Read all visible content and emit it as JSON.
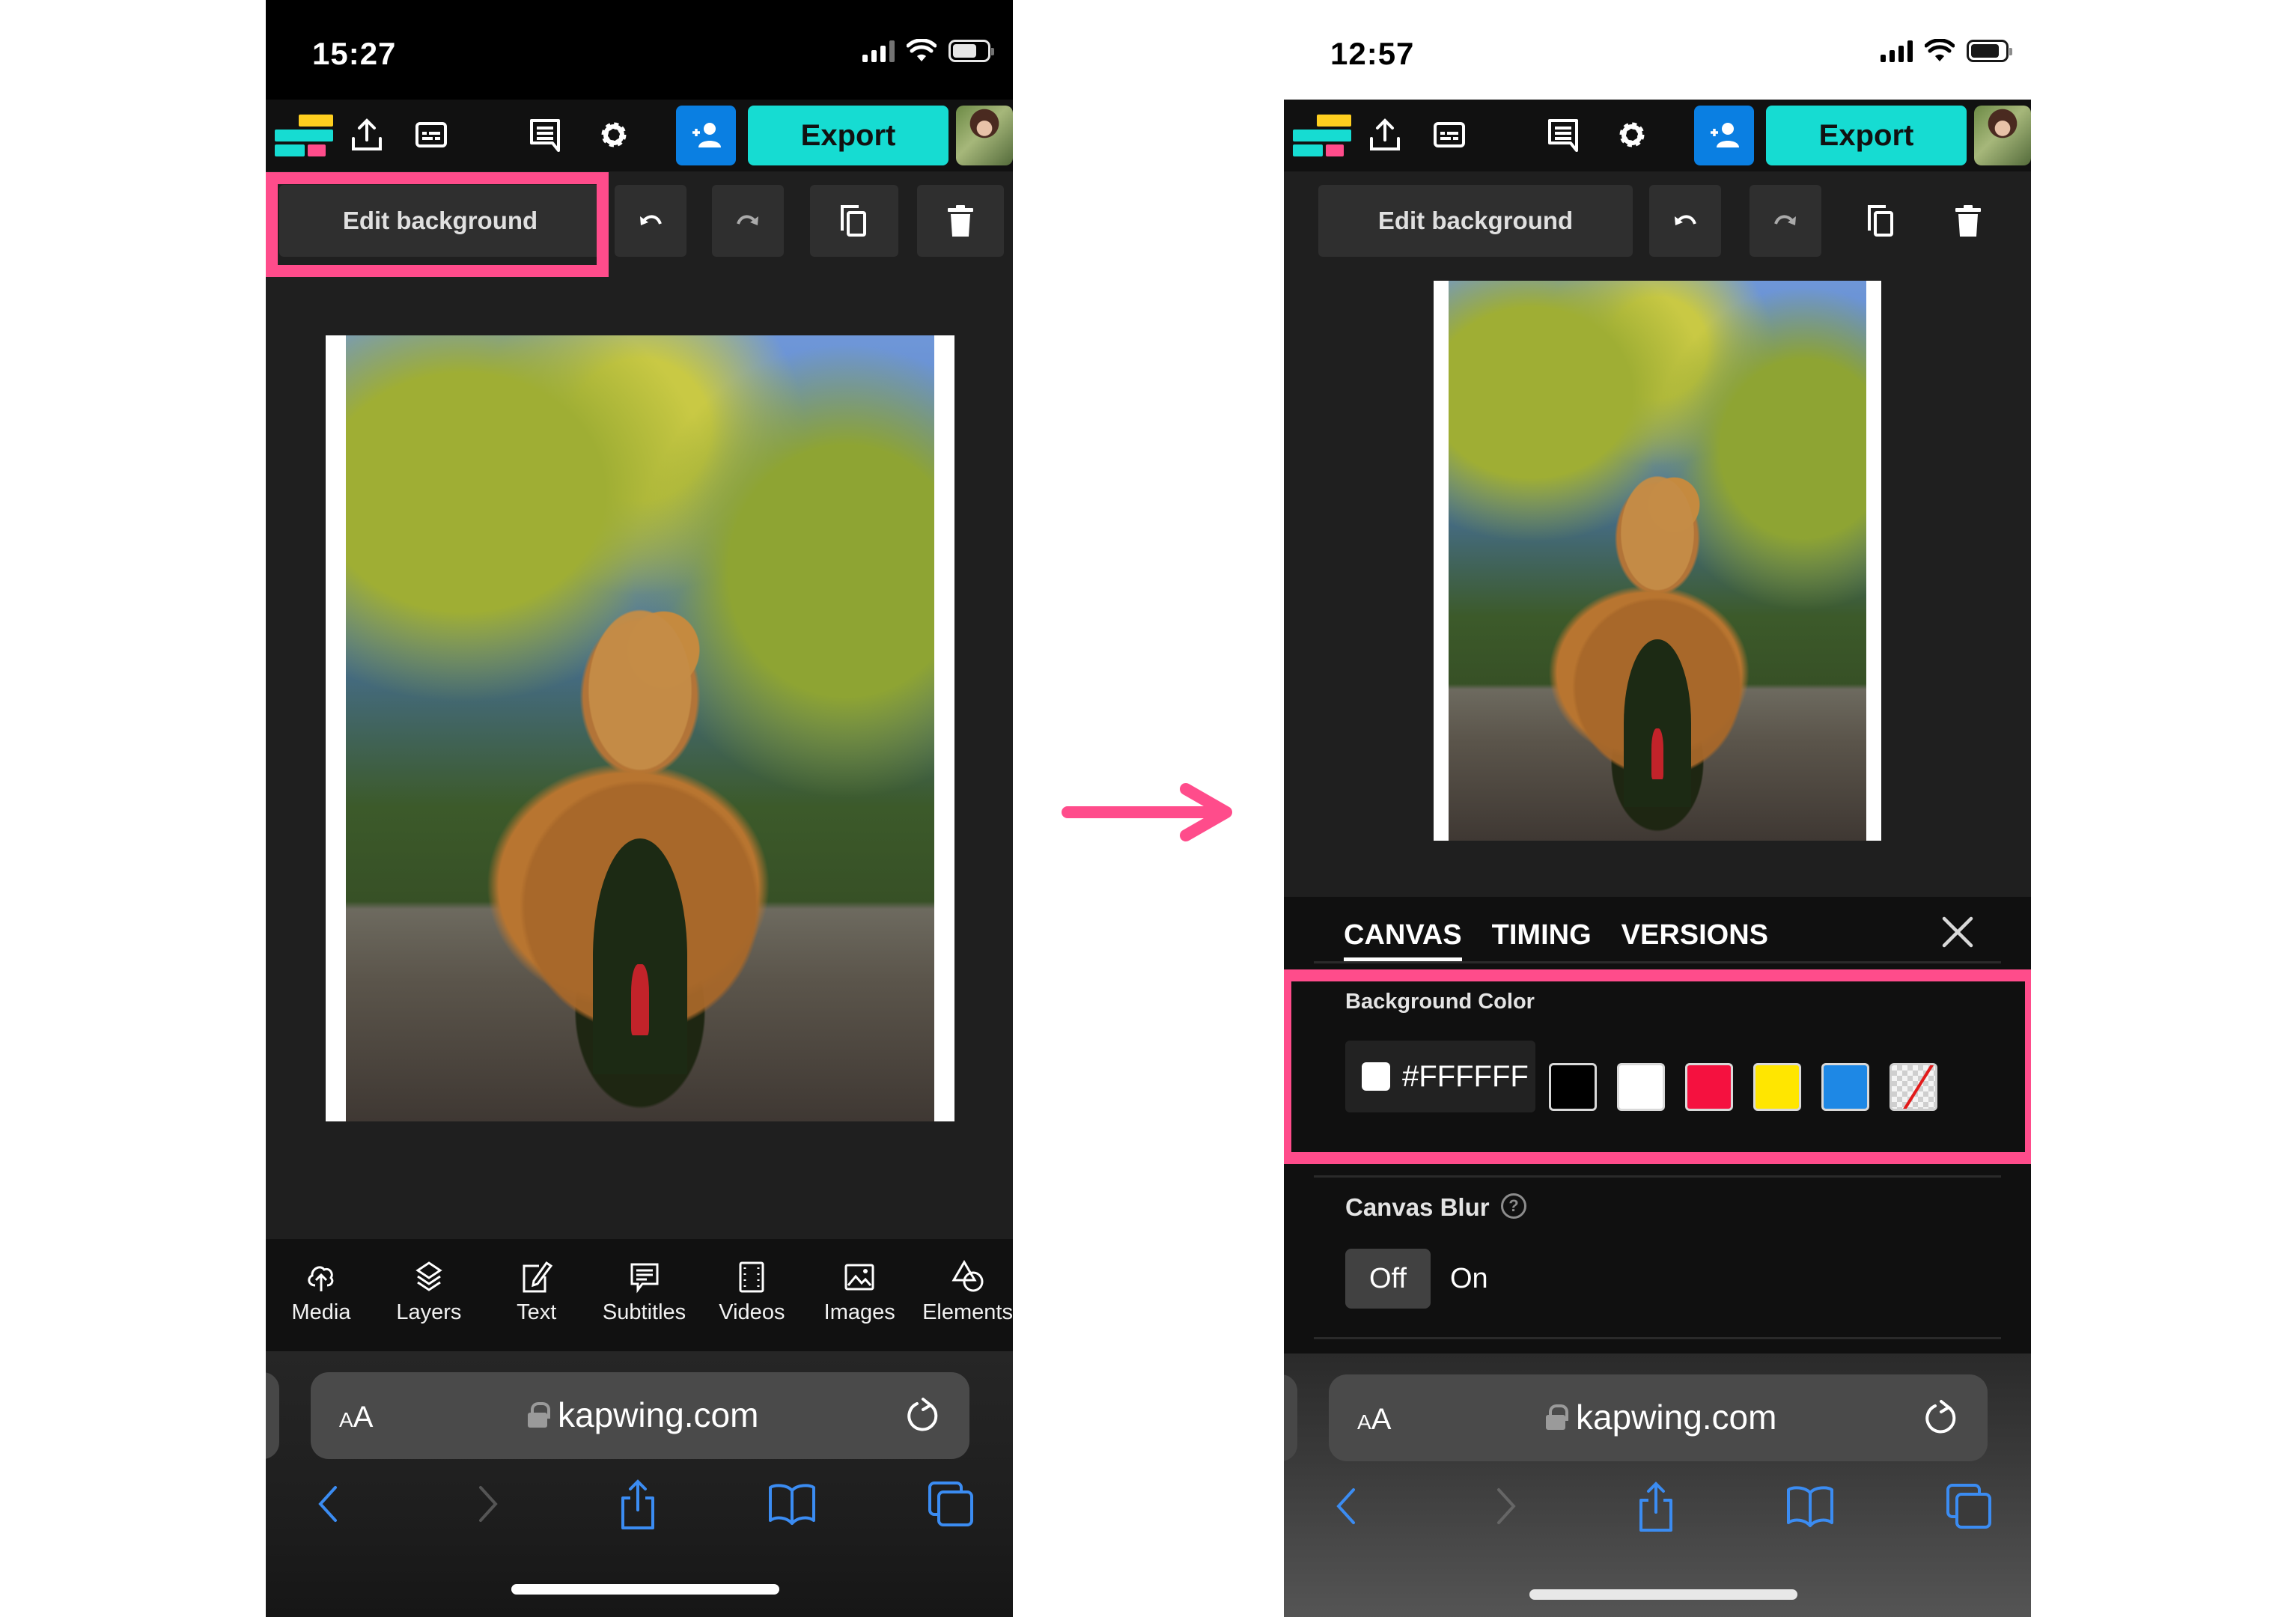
{
  "colors": {
    "highlight": "#ff4c8b",
    "export_button": "#16dcd2",
    "invite_button": "#0a7fe2",
    "safari_accent": "#3b8cf2"
  },
  "left_phone": {
    "status": {
      "time": "15:27"
    },
    "appbar": {
      "icons": [
        "kapwing-logo",
        "upload-icon",
        "subtitles-icon",
        "comment-icon",
        "gear-icon",
        "invite-user-icon"
      ],
      "export_label": "Export"
    },
    "edit_toolbar": {
      "edit_background_label": "Edit background",
      "buttons": [
        "undo-icon",
        "redo-icon",
        "duplicate-icon",
        "trash-icon"
      ]
    },
    "tools": [
      {
        "label": "Media",
        "icon": "cloud-upload-icon"
      },
      {
        "label": "Layers",
        "icon": "layers-icon"
      },
      {
        "label": "Text",
        "icon": "edit-text-icon"
      },
      {
        "label": "Subtitles",
        "icon": "subtitles-bubble-icon"
      },
      {
        "label": "Videos",
        "icon": "film-icon"
      },
      {
        "label": "Images",
        "icon": "image-icon"
      },
      {
        "label": "Elements",
        "icon": "shapes-icon"
      }
    ],
    "safari": {
      "text_size_label": "AA",
      "url": "kapwing.com"
    }
  },
  "right_phone": {
    "status": {
      "time": "12:57"
    },
    "appbar": {
      "export_label": "Export"
    },
    "edit_toolbar": {
      "edit_background_label": "Edit background"
    },
    "panel": {
      "tabs": [
        {
          "label": "CANVAS",
          "active": true
        },
        {
          "label": "TIMING",
          "active": false
        },
        {
          "label": "VERSIONS",
          "active": false
        }
      ],
      "background_color": {
        "label": "Background Color",
        "hex_value": "#FFFFFF",
        "swatches": [
          {
            "name": "black",
            "color": "#000000"
          },
          {
            "name": "white",
            "color": "#ffffff"
          },
          {
            "name": "red",
            "color": "#f5113f"
          },
          {
            "name": "yellow",
            "color": "#ffe600"
          },
          {
            "name": "blue",
            "color": "#1e88e5"
          },
          {
            "name": "transparent",
            "color": "transparent"
          }
        ]
      },
      "canvas_blur": {
        "label": "Canvas Blur",
        "help": "?",
        "options": [
          "Off",
          "On"
        ],
        "selected": "Off"
      }
    },
    "safari": {
      "text_size_label": "AA",
      "url": "kapwing.com"
    }
  }
}
